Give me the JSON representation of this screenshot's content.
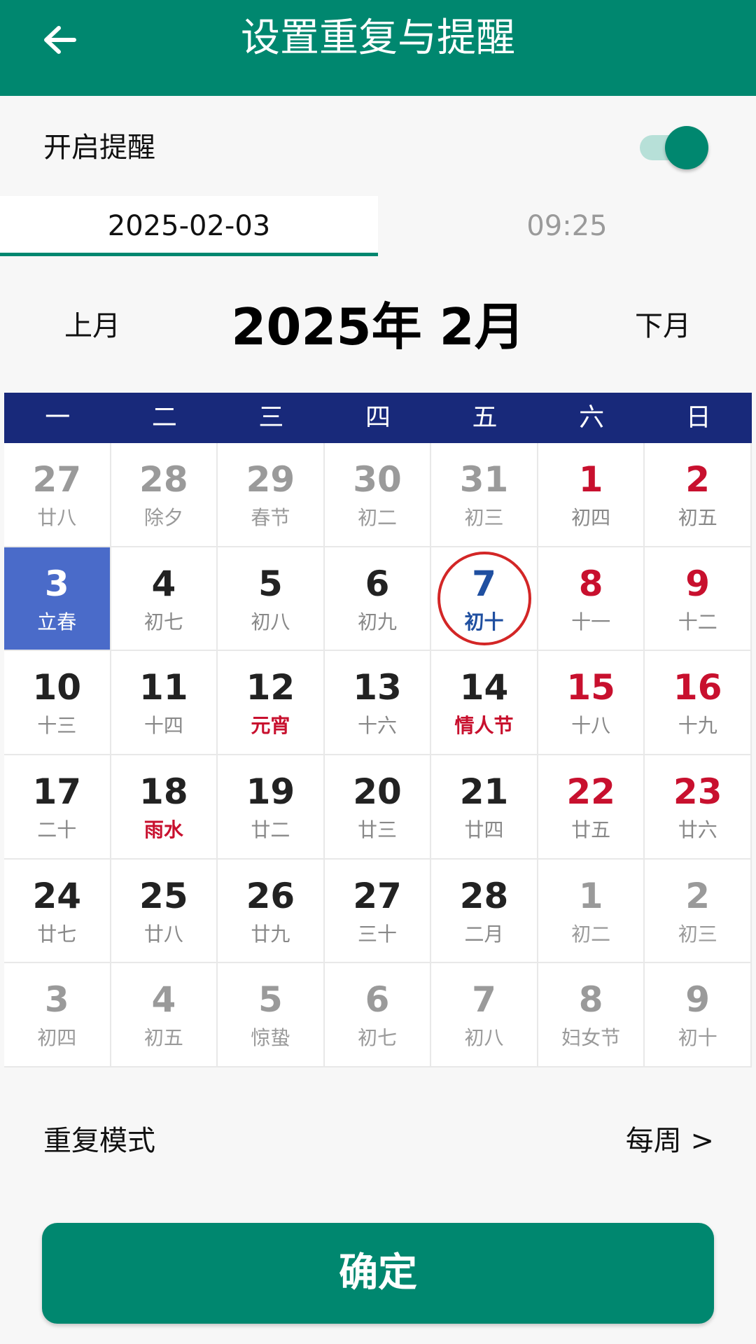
{
  "header": {
    "title": "设置重复与提醒",
    "back_icon": "arrow-left-icon"
  },
  "reminder": {
    "label": "开启提醒",
    "enabled": true
  },
  "tabs": {
    "date": "2025-02-03",
    "time": "09:25"
  },
  "calendar": {
    "prev_label": "上月",
    "next_label": "下月",
    "month_title": "2025年 2月",
    "weekdays": [
      "一",
      "二",
      "三",
      "四",
      "五",
      "六",
      "日"
    ],
    "days": [
      {
        "d": "27",
        "l": "廿八",
        "other": true
      },
      {
        "d": "28",
        "l": "除夕",
        "other": true
      },
      {
        "d": "29",
        "l": "春节",
        "other": true
      },
      {
        "d": "30",
        "l": "初二",
        "other": true
      },
      {
        "d": "31",
        "l": "初三",
        "other": true
      },
      {
        "d": "1",
        "l": "初四",
        "weekend": true
      },
      {
        "d": "2",
        "l": "初五",
        "weekend": true
      },
      {
        "d": "3",
        "l": "立春",
        "selected": true
      },
      {
        "d": "4",
        "l": "初七"
      },
      {
        "d": "5",
        "l": "初八"
      },
      {
        "d": "6",
        "l": "初九"
      },
      {
        "d": "7",
        "l": "初十",
        "today": true
      },
      {
        "d": "8",
        "l": "十一",
        "weekend": true
      },
      {
        "d": "9",
        "l": "十二",
        "weekend": true
      },
      {
        "d": "10",
        "l": "十三"
      },
      {
        "d": "11",
        "l": "十四"
      },
      {
        "d": "12",
        "l": "元宵",
        "festival": true
      },
      {
        "d": "13",
        "l": "十六"
      },
      {
        "d": "14",
        "l": "情人节",
        "festival": true
      },
      {
        "d": "15",
        "l": "十八",
        "weekend": true
      },
      {
        "d": "16",
        "l": "十九",
        "weekend": true
      },
      {
        "d": "17",
        "l": "二十"
      },
      {
        "d": "18",
        "l": "雨水",
        "festival": true
      },
      {
        "d": "19",
        "l": "廿二"
      },
      {
        "d": "20",
        "l": "廿三"
      },
      {
        "d": "21",
        "l": "廿四"
      },
      {
        "d": "22",
        "l": "廿五",
        "weekend": true
      },
      {
        "d": "23",
        "l": "廿六",
        "weekend": true
      },
      {
        "d": "24",
        "l": "廿七"
      },
      {
        "d": "25",
        "l": "廿八"
      },
      {
        "d": "26",
        "l": "廿九"
      },
      {
        "d": "27",
        "l": "三十"
      },
      {
        "d": "28",
        "l": "二月"
      },
      {
        "d": "1",
        "l": "初二",
        "other": true
      },
      {
        "d": "2",
        "l": "初三",
        "other": true
      },
      {
        "d": "3",
        "l": "初四",
        "other": true
      },
      {
        "d": "4",
        "l": "初五",
        "other": true
      },
      {
        "d": "5",
        "l": "惊蛰",
        "other": true
      },
      {
        "d": "6",
        "l": "初七",
        "other": true
      },
      {
        "d": "7",
        "l": "初八",
        "other": true
      },
      {
        "d": "8",
        "l": "妇女节",
        "other": true
      },
      {
        "d": "9",
        "l": "初十",
        "other": true
      }
    ]
  },
  "repeat": {
    "label": "重复模式",
    "value": "每周 >"
  },
  "confirm_label": "确定",
  "colors": {
    "primary": "#00876f",
    "week_header": "#18297a",
    "selected": "#4a6bc9",
    "holiday_red": "#c8102e",
    "today_ring": "#d32626"
  }
}
